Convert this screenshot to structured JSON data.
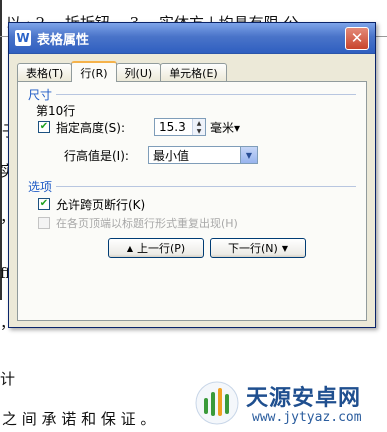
{
  "document": {
    "lines": [
      {
        "text": "以 ; 2、 拆折钮， 3、 实体方 | 均具有限 公"
      },
      {
        "text": "子"
      },
      {
        "text": "实 例"
      },
      {
        "text": "， 拍"
      },
      {
        "text": "ff"
      },
      {
        "text": "，"
      },
      {
        "text": "计"
      },
      {
        "text": "之 间 承 诺 和 保 证 。"
      }
    ]
  },
  "dialog": {
    "title": "表格属性",
    "app_icon_letter": "W",
    "tabs": [
      {
        "label": "表格(T)"
      },
      {
        "label": "行(R)"
      },
      {
        "label": "列(U)"
      },
      {
        "label": "单元格(E)"
      }
    ],
    "size_group": {
      "title": "尺寸",
      "row_label": "第10行",
      "specify_height_label": "指定高度(S):",
      "specify_height_checked": true,
      "height_value": "15.3",
      "unit_label": "毫米▾",
      "row_height_is_label": "行高值是(I):",
      "row_height_is_value": "最小值"
    },
    "options_group": {
      "title": "选项",
      "allow_break_label": "允许跨页断行(K)",
      "allow_break_checked": true,
      "repeat_header_label": "在各页顶端以标题行形式重复出现(H)",
      "repeat_header_checked": false
    },
    "prev_row_button": "上一行(P)",
    "next_row_button": "下一行(N)"
  },
  "watermark": {
    "title": "天源安卓网",
    "url": "www.jytyaz.com"
  },
  "colors": {
    "titlebar": "#2f5fc0",
    "group_title": "#1f5bc6",
    "check_mark": "#21a121"
  }
}
